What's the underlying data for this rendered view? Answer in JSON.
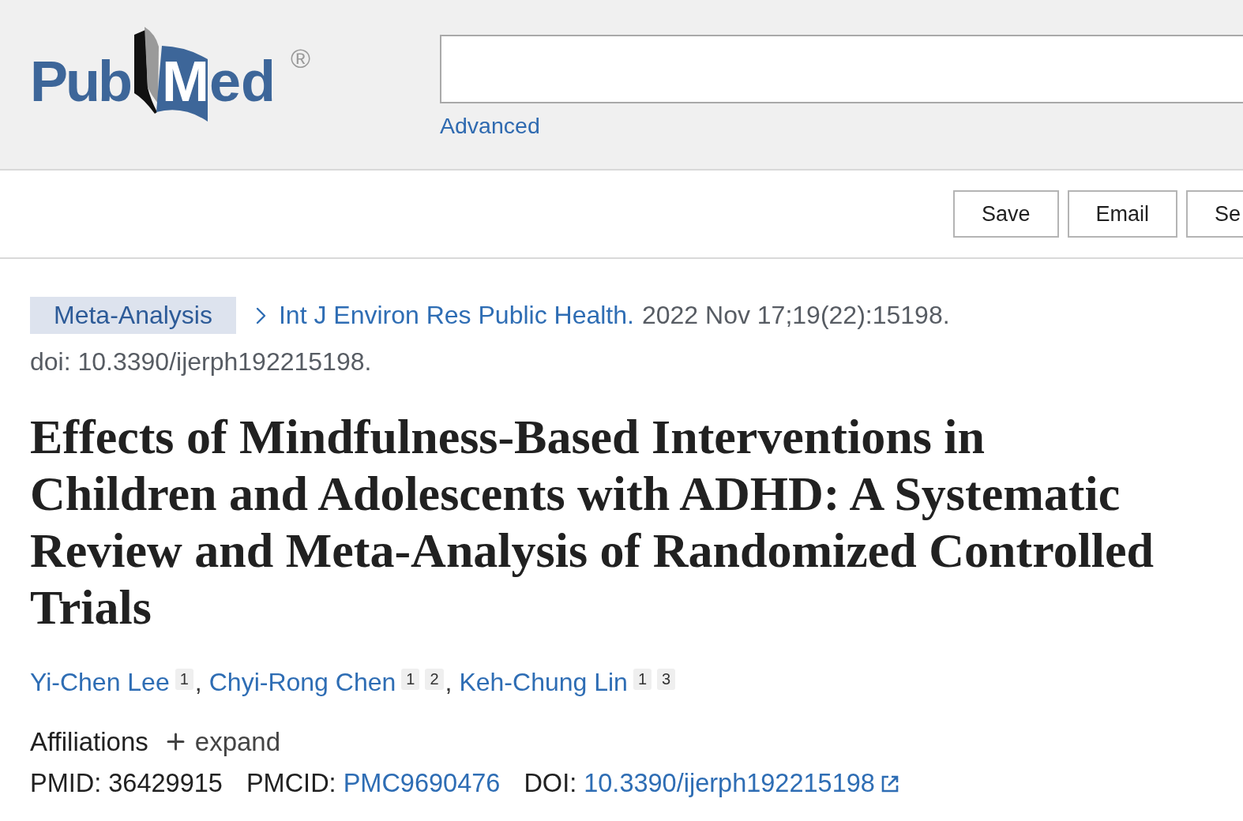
{
  "header": {
    "logo": {
      "text": "Pub",
      "text_on_book": "Med",
      "registered_mark": "®"
    },
    "advanced_link": "Advanced"
  },
  "toolbar": {
    "buttons": [
      "Save",
      "Email",
      "Se"
    ]
  },
  "article": {
    "publication_type": "Meta-Analysis",
    "journal": "Int J Environ Res Public Health.",
    "citation": "2022 Nov 17;19(22):15198.",
    "doi_line": "doi: 10.3390/ijerph192215198.",
    "title": "Effects of Mindfulness-Based Interventions in Children and Adolescents with ADHD: A Systematic Review and Meta-Analysis of Randomized Controlled Trials",
    "authors": [
      {
        "name": "Yi-Chen Lee",
        "affiliations": [
          "1"
        ],
        "separator": ","
      },
      {
        "name": "Chyi-Rong Chen",
        "affiliations": [
          "1",
          "2"
        ],
        "separator": ","
      },
      {
        "name": "Keh-Chung Lin",
        "affiliations": [
          "1",
          "3"
        ]
      }
    ],
    "affiliations": {
      "label": "Affiliations",
      "toggle": "expand",
      "expanded": false
    },
    "identifiers": [
      {
        "kind": "text",
        "label": "PMID:",
        "value": "36429915"
      },
      {
        "kind": "link",
        "label": "PMCID:",
        "value": "PMC9690476"
      },
      {
        "kind": "external_link",
        "label": "DOI:",
        "value": "10.3390/ijerph192215198"
      }
    ]
  }
}
